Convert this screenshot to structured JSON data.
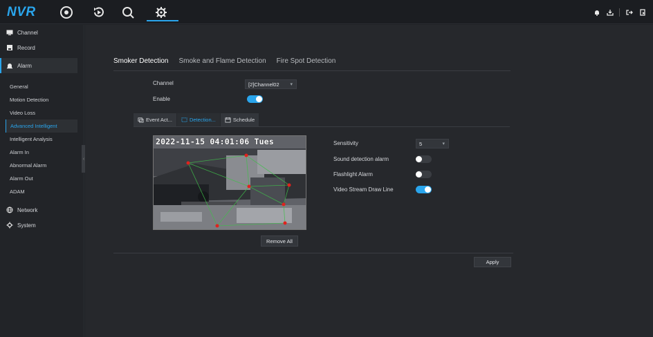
{
  "app": {
    "logo": "NVR"
  },
  "topnav": {
    "icons": [
      "live-view-icon",
      "playback-icon",
      "search-icon",
      "settings-icon"
    ],
    "active": "settings-icon",
    "right_icons": [
      "bell-icon",
      "download-icon",
      "logout-icon",
      "exit-icon"
    ]
  },
  "sidebar": {
    "channel": "Channel",
    "record": "Record",
    "alarm": "Alarm",
    "alarm_items": [
      "General",
      "Motion Detection",
      "Video Loss",
      "Advanced Intelligent",
      "Intelligent Analysis",
      "Alarm In",
      "Abnormal Alarm",
      "Alarm Out",
      "ADAM"
    ],
    "active_item": "Advanced Intelligent",
    "network": "Network",
    "system": "System"
  },
  "tabs": [
    "Smoker Detection",
    "Smoke and Flame Detection",
    "Fire Spot Detection"
  ],
  "active_tab": "Smoker Detection",
  "form": {
    "channel_label": "Channel",
    "channel_value": "[2]Channel02",
    "enable_label": "Enable",
    "enable_on": true
  },
  "subtabs": {
    "event": "Event Act...",
    "detection": "Detection...",
    "schedule": "Schedule",
    "active": "Detection..."
  },
  "video": {
    "osd": "2022-11-15 04:01:06 Tues"
  },
  "settings": {
    "sensitivity_label": "Sensitivity",
    "sensitivity_value": "5",
    "sound_label": "Sound detection alarm",
    "sound_on": false,
    "flashlight_label": "Flashlight Alarm",
    "flashlight_on": false,
    "drawline_label": "Video Stream Draw Line",
    "drawline_on": true
  },
  "buttons": {
    "remove_all": "Remove All",
    "apply": "Apply"
  },
  "colors": {
    "accent": "#2aa5ec",
    "marker": "#e0221e",
    "region_line": "#3fbf4a"
  }
}
